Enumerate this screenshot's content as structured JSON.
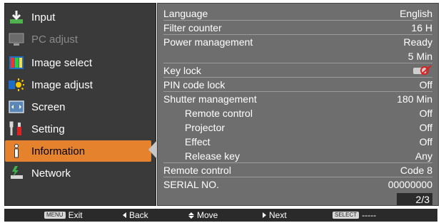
{
  "menu": {
    "items": [
      {
        "label": "Input",
        "icon": "input-icon",
        "state": "normal"
      },
      {
        "label": "PC adjust",
        "icon": "pc-adjust-icon",
        "state": "disabled"
      },
      {
        "label": "Image select",
        "icon": "image-select-icon",
        "state": "normal"
      },
      {
        "label": "Image adjust",
        "icon": "image-adjust-icon",
        "state": "normal"
      },
      {
        "label": "Screen",
        "icon": "screen-icon",
        "state": "normal"
      },
      {
        "label": "Setting",
        "icon": "setting-icon",
        "state": "normal"
      },
      {
        "label": "Information",
        "icon": "information-icon",
        "state": "active"
      },
      {
        "label": "Network",
        "icon": "network-icon",
        "state": "normal"
      }
    ],
    "accent_color": "#e5822e"
  },
  "settings": {
    "rows": [
      {
        "label": "Language",
        "value": "English"
      },
      {
        "label": "Filter counter",
        "value": "16 H"
      },
      {
        "label": "Power management",
        "value": "Ready"
      },
      {
        "label": "",
        "value": "5 Min"
      },
      {
        "label": "Key lock",
        "value": "",
        "icon": "key-lock-icon"
      },
      {
        "label": "PIN code lock",
        "value": "Off"
      },
      {
        "label": "Shutter management",
        "value": "180 Min"
      },
      {
        "label": "Remote control",
        "value": "Off"
      },
      {
        "label": "Projector",
        "value": "Off"
      },
      {
        "label": "Effect",
        "value": "Off"
      },
      {
        "label": "Release key",
        "value": "Any"
      },
      {
        "label": "Remote control",
        "value": "Code 8"
      },
      {
        "label": "SERIAL NO.",
        "value": "00000000"
      }
    ],
    "page": "2/3"
  },
  "footer": {
    "exit_key": "MENU",
    "exit_label": "Exit",
    "back_label": "Back",
    "move_label": "Move",
    "next_label": "Next",
    "select_key": "SELECT",
    "select_label": "-----"
  }
}
